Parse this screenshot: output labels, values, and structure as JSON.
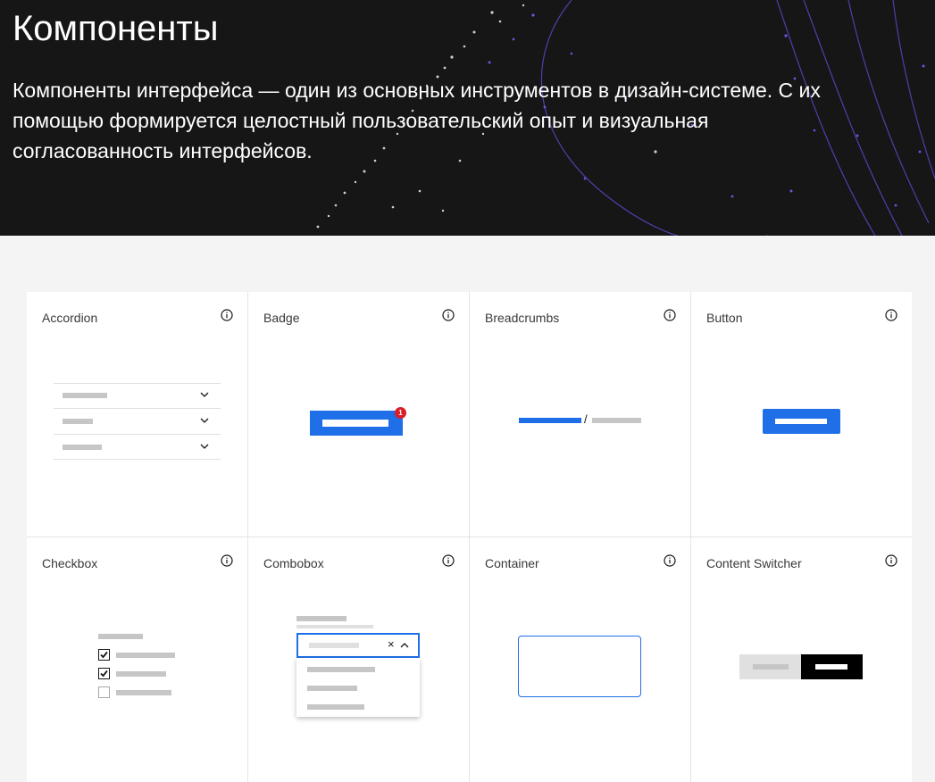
{
  "hero": {
    "title": "Компоненты",
    "lead": "Компоненты интерфейса — один из основных инструментов в дизайн-системе. С их помощью формируется целостный пользовательский опыт и визуальная согласованность интерфейсов."
  },
  "colors": {
    "hero_bg": "#161616",
    "page_bg": "#f4f4f4",
    "accent": "#1f6fe8",
    "badge": "#da1e28"
  },
  "components": [
    {
      "name": "Accordion",
      "icon": "info-icon"
    },
    {
      "name": "Badge",
      "icon": "info-icon",
      "badge_count": "1"
    },
    {
      "name": "Breadcrumbs",
      "icon": "info-icon",
      "separator": "/"
    },
    {
      "name": "Button",
      "icon": "info-icon"
    },
    {
      "name": "Checkbox",
      "icon": "info-icon"
    },
    {
      "name": "Combobox",
      "icon": "info-icon",
      "clear_glyph": "×"
    },
    {
      "name": "Container",
      "icon": "info-icon"
    },
    {
      "name": "Content Switcher",
      "icon": "info-icon"
    }
  ]
}
